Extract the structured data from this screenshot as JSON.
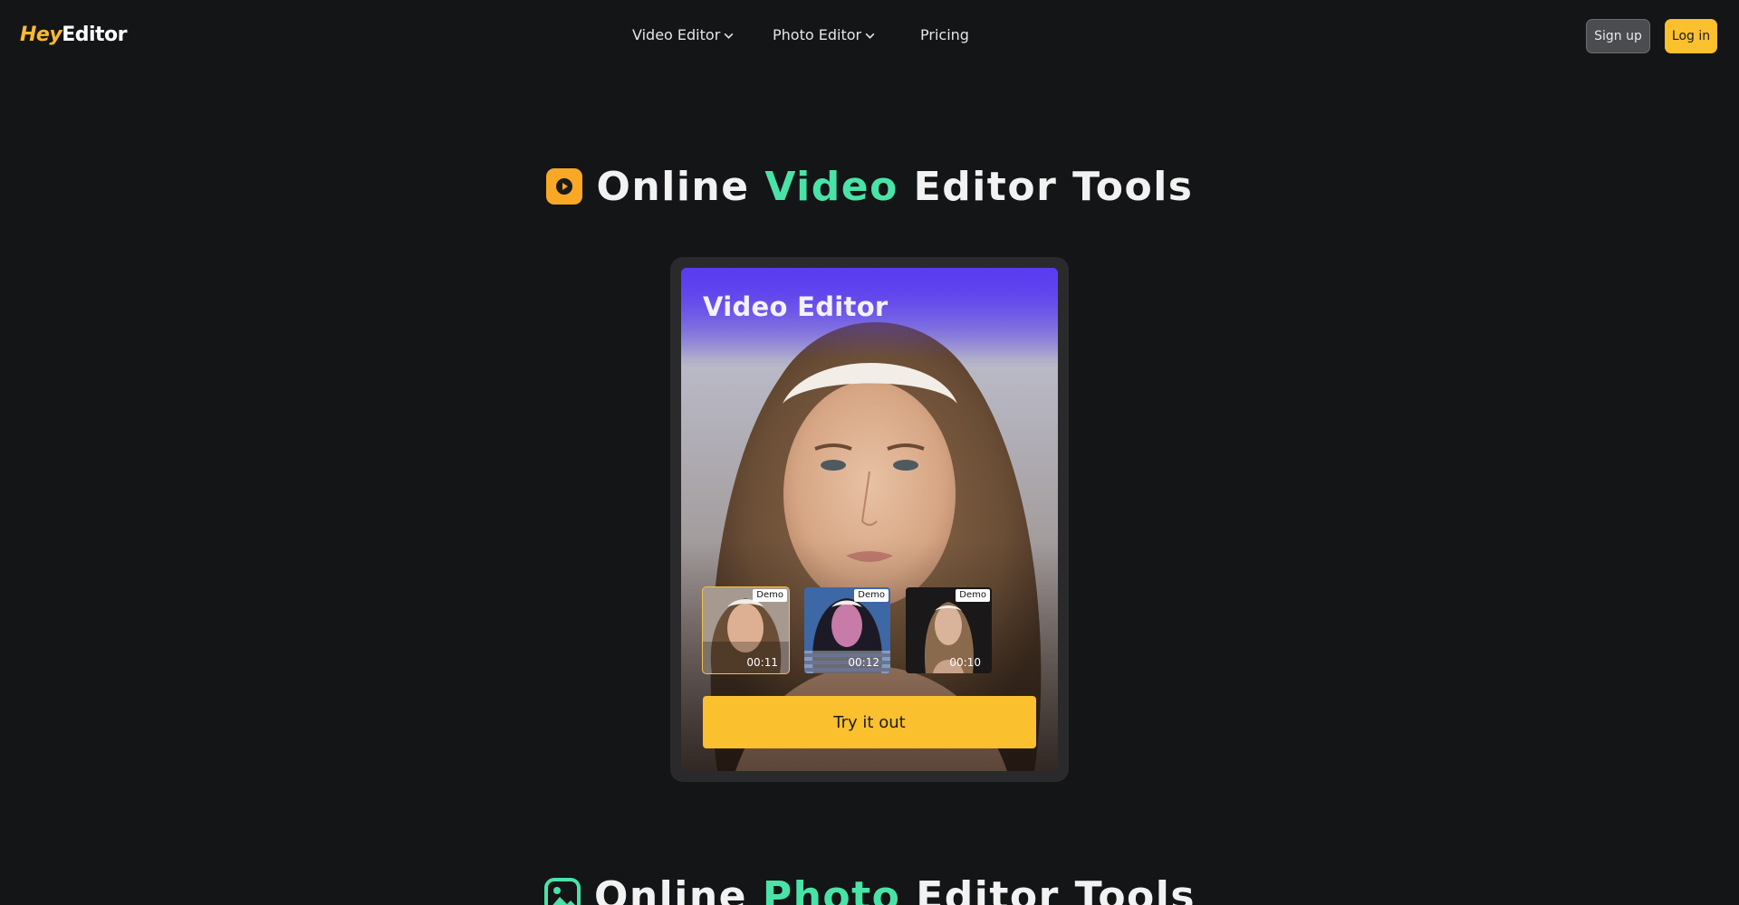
{
  "header": {
    "logo": {
      "part1": "Hey",
      "part2": "Editor"
    },
    "nav": [
      {
        "label": "Video Editor",
        "has_dropdown": true
      },
      {
        "label": "Photo Editor",
        "has_dropdown": true
      },
      {
        "label": "Pricing",
        "has_dropdown": false
      }
    ],
    "signup_label": "Sign up",
    "login_label": "Log in"
  },
  "video_section": {
    "title_pre": "Online",
    "title_accent": "Video",
    "title_post": "Editor Tools"
  },
  "card": {
    "title": "Video Editor",
    "thumbnails": [
      {
        "tag": "Demo",
        "duration": "00:11",
        "selected": true
      },
      {
        "tag": "Demo",
        "duration": "00:12",
        "selected": false
      },
      {
        "tag": "Demo",
        "duration": "00:10",
        "selected": false
      }
    ],
    "cta_label": "Try it out"
  },
  "photo_section": {
    "title_pre": "Online",
    "title_accent": "Photo",
    "title_post": "Editor Tools"
  },
  "colors": {
    "background": "#131517",
    "accent_green": "#4ae3a7",
    "brand_yellow": "#fbc02d",
    "card_purple": "#5a3cf0"
  },
  "icons": [
    "play-icon",
    "image-icon",
    "chevron-down-icon"
  ]
}
